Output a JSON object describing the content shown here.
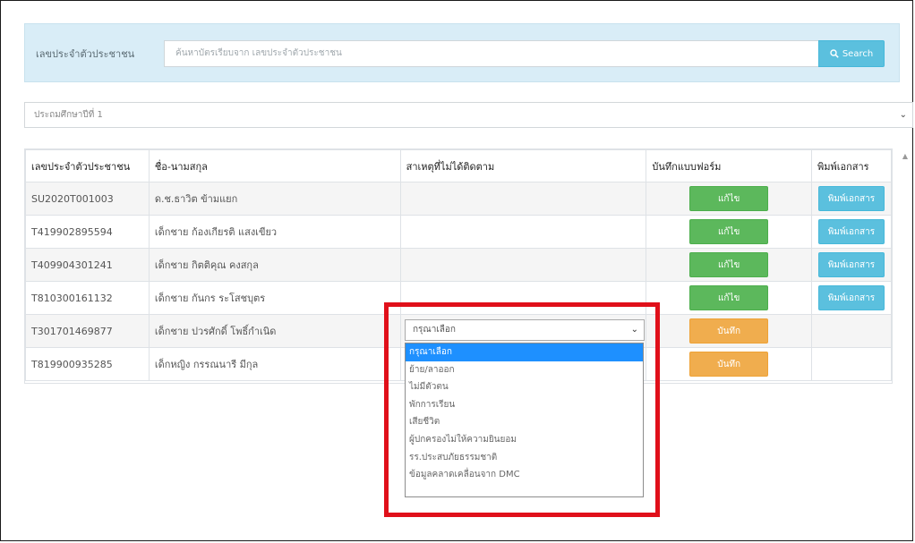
{
  "search": {
    "label": "เลขประจำตัวประชาชน",
    "placeholder": "ค้นหาบัตรเรียบจาก เลขประจำตัวประชาชน",
    "button_label": "Search",
    "icon": "search-icon"
  },
  "year_filter": {
    "selected": "ประถมศึกษาปีที่ 1"
  },
  "table": {
    "headers": [
      "เลขประจำตัวประชาชน",
      "ชื่อ-นามสกุล",
      "สาเหตุที่ไม่ได้ติดตาม",
      "บันทึกแบบฟอร์ม",
      "พิมพ์เอกสาร"
    ],
    "rows": [
      {
        "id": "SU2020T001003",
        "name": "ด.ช.ธาวิต ข้ามแยก",
        "form": "แก้ไข",
        "print": "พิมพ์เอกสาร"
      },
      {
        "id": "T419902895594",
        "name": "เด็กชาย ก้องเกียรติ แสงเขียว",
        "form": "แก้ไข",
        "print": "พิมพ์เอกสาร"
      },
      {
        "id": "T409904301241",
        "name": "เด็กชาย กิตติคุณ คงสกุล",
        "form": "แก้ไข",
        "print": "พิมพ์เอกสาร"
      },
      {
        "id": "T810300161132",
        "name": "เด็กชาย กันกร ระโสชบุตร",
        "form": "แก้ไข",
        "print": "พิมพ์เอกสาร"
      },
      {
        "id": "T301701469877",
        "name": "เด็กชาย ปวรศักดิ์ โพธิ์กำเนิด",
        "form": "บันทึก"
      },
      {
        "id": "T819900935285",
        "name": "เด็กหญิง กรรณนารี มีกุล",
        "form": "บันทึก"
      }
    ]
  },
  "reason_select": {
    "selected": "กรุณาเลือก",
    "options": [
      "กรุณาเลือก",
      "ย้าย/ลาออก",
      "ไม่มีตัวตน",
      "พักการเรียน",
      "เสียชีวิต",
      "ผู้ปกครองไม่ให้ความยินยอม",
      "รร.ประสบภัยธรรมชาติ",
      "ข้อมูลคลาดเคลื่อนจาก DMC"
    ]
  },
  "colors": {
    "search_panel": "#d9edf7",
    "btn_green": "#5cb85c",
    "btn_orange": "#f0ad4e",
    "btn_blue": "#5bc0de",
    "highlight": "#e0101a",
    "selected_option": "#1e90ff"
  }
}
